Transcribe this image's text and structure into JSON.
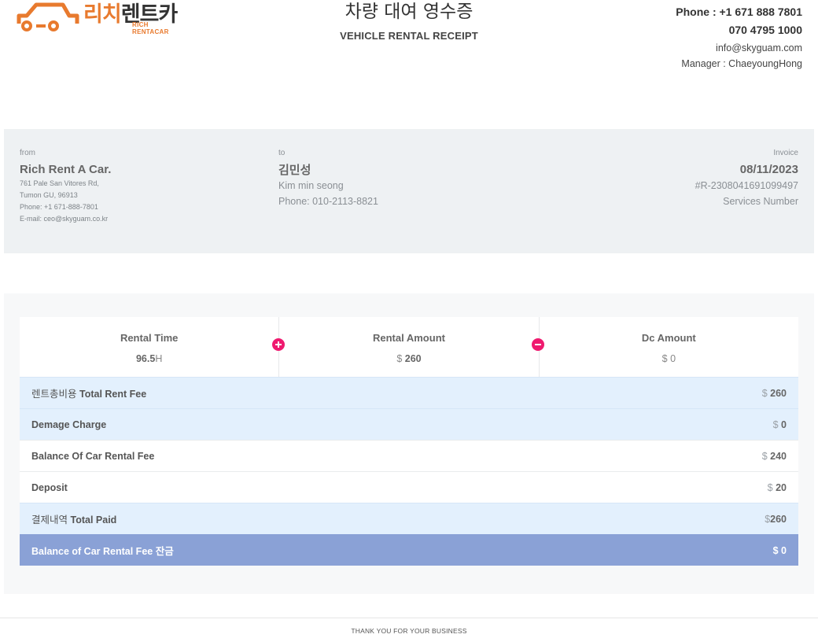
{
  "brand": {
    "name_kr_orange": "리치",
    "name_kr_dark": "렌트카",
    "name_en": "RICH RENTACAR",
    "color_orange": "#e87a2e"
  },
  "title": {
    "kr": "차량 대여 영수증",
    "en": "VEHICLE RENTAL RECEIPT"
  },
  "contact": {
    "phone": "Phone : +1 671 888 7801",
    "phone2": "070 4795 1000",
    "email": "info@skyguam.com",
    "manager": "Manager : ChaeyoungHong"
  },
  "from": {
    "label": "from",
    "name": "Rich Rent A Car.",
    "address1": "761 Pale San Vitores Rd,",
    "address2": "Tumon GU, 96913",
    "phone": "Phone: +1 671-888-7801",
    "email": "E-mail: ceo@skyguam.co.kr"
  },
  "to": {
    "label": "to",
    "name_kr": "김민성",
    "name_en": "Kim min seong",
    "phone": "Phone: 010-2113-8821"
  },
  "invoice": {
    "label": "Invoice",
    "date": "08/11/2023",
    "number": "#R-2308041691099497",
    "number_label": "Services Number"
  },
  "stats": {
    "rental_time_label": "Rental Time",
    "rental_time_value": "96.5",
    "rental_time_unit": "H",
    "rental_amount_label": "Rental Amount",
    "rental_amount_currency": "$",
    "rental_amount_value": "260",
    "dc_amount_label": "Dc Amount",
    "dc_amount_currency": "$",
    "dc_amount_value": "0",
    "plus_icon": "plus-circle-icon",
    "minus_icon": "minus-circle-icon",
    "icon_color": "#ef1a6f"
  },
  "rows": {
    "total_rent_fee_kr": "렌트총비용",
    "total_rent_fee_en": "Total Rent Fee",
    "total_rent_fee_cur": "$",
    "total_rent_fee_val": "260",
    "damage_label": "Demage Charge",
    "damage_cur": "$",
    "damage_val": "0",
    "balance_label": "Balance Of Car Rental Fee",
    "balance_cur": "$",
    "balance_val": "240",
    "deposit_label": "Deposit",
    "deposit_cur": "$",
    "deposit_val": "20",
    "total_paid_kr": "결제내역",
    "total_paid_en": "Total Paid",
    "total_paid_cur": "$",
    "total_paid_val": "260",
    "final_label_en": "Balance of Car Rental Fee",
    "final_label_kr": "잔금",
    "final_cur": "$",
    "final_val": "0",
    "row_blue_color": "#e3f0fd",
    "row_final_color": "#8aa1d6"
  },
  "footer": {
    "text": "THANK YOU FOR YOUR BUSINESS"
  }
}
